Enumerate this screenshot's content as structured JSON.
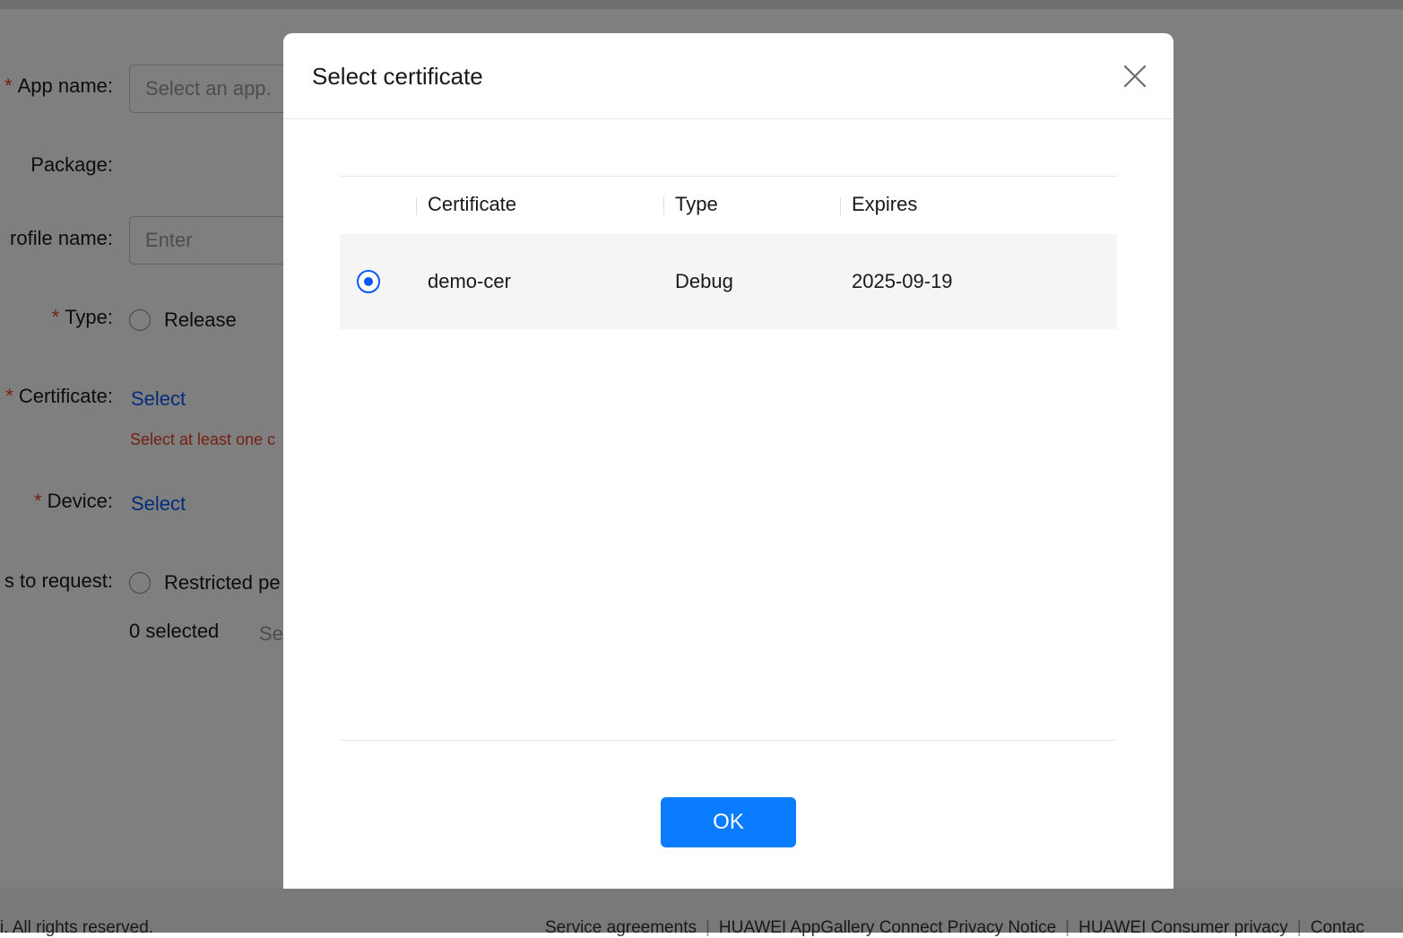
{
  "background_form": {
    "app_name": {
      "label": "App name:",
      "placeholder": "Select an app."
    },
    "package": {
      "label": "Package:"
    },
    "profile_name": {
      "label": "rofile name:",
      "placeholder": "Enter"
    },
    "type": {
      "label": "Type:",
      "option": "Release"
    },
    "certificate": {
      "label": "Certificate:",
      "link": "Select",
      "error": "Select at least one c"
    },
    "device": {
      "label": "Device:",
      "link": "Select"
    },
    "permissions": {
      "label": "s to request:",
      "option": "Restricted pe",
      "selected_count": "0 selected",
      "select_link": "Se"
    },
    "required_mark": "*"
  },
  "footer": {
    "copyright": "i. All rights reserved.",
    "links": [
      "Service agreements",
      "HUAWEI AppGallery Connect Privacy Notice",
      "HUAWEI Consumer privacy",
      "Contac"
    ],
    "separator": "|"
  },
  "modal": {
    "title": "Select certificate",
    "close_icon": "close-icon",
    "columns": [
      "Certificate",
      "Type",
      "Expires"
    ],
    "rows": [
      {
        "selected": true,
        "certificate": "demo-cer",
        "type": "Debug",
        "expires": "2025-09-19"
      }
    ],
    "ok_label": "OK"
  },
  "colors": {
    "accent": "#0a59f7",
    "ok_button": "#0a7cff",
    "error": "#e84026",
    "overlay": "rgba(0,0,0,0.5)"
  }
}
